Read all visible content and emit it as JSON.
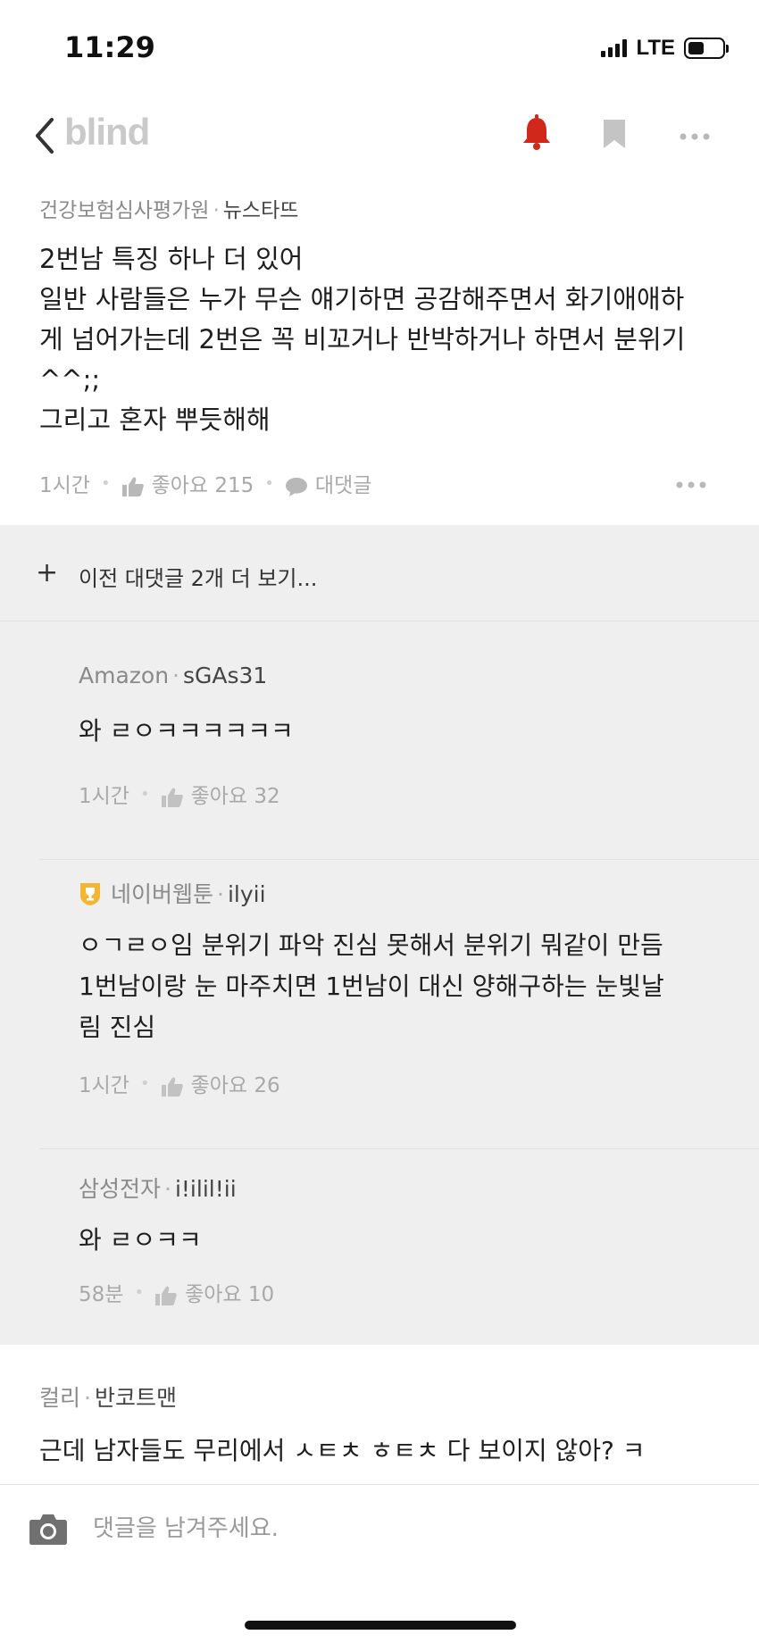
{
  "status_bar": {
    "time": "11:29",
    "network": "LTE",
    "battery_level": 0.48
  },
  "nav": {
    "logo": "blind",
    "accent_color": "#d0281b",
    "icons": [
      "back-chevron-icon",
      "bell-icon",
      "bookmark-icon",
      "more-icon"
    ]
  },
  "main_comment": {
    "company": "건강보험심사평가원",
    "nickname": "뉴스타뜨",
    "body": "2번남 특징 하나 더 있어\n일반 사람들은 누가 무슨 얘기하면 공감해주면서 화기애애하\n게 넘어가는데 2번은 꼭 비꼬거나 반박하거나 하면서 분위기\n^^;;\n그리고 혼자 뿌듯해해",
    "time": "1시간",
    "like_label": "좋아요 215",
    "reply_label": "대댓글"
  },
  "load_more": {
    "plus": "+",
    "label": "이전 대댓글 2개 더 보기..."
  },
  "replies": [
    {
      "company": "Amazon",
      "nickname": "sGAs31",
      "body": "와 ㄹㅇㅋㅋㅋㅋㅋㅋ",
      "time": "1시간",
      "like_label": "좋아요 32"
    },
    {
      "company": "네이버웹툰",
      "nickname": "ilyii",
      "body": "ㅇㄱㄹㅇ임 분위기 파악 진심 못해서 분위기 뭐같이 만듬\n1번남이랑 눈 마주치면 1번남이 대신 양해구하는 눈빛날\n림 진심",
      "time": "1시간",
      "like_label": "좋아요 26"
    },
    {
      "company": "삼성전자",
      "nickname": "i!ilil!ii",
      "body": "와 ㄹㅇㅋㅋ",
      "time": "58분",
      "like_label": "좋아요 10"
    }
  ],
  "next_comment": {
    "company": "컬리",
    "nickname": "반코트맨",
    "body": "근데 남자들도 무리에서 ㅅㅌㅊ ㅎㅌㅊ 다 보이지 않아? ㅋ"
  },
  "input": {
    "placeholder": "댓글을 남겨주세요."
  }
}
